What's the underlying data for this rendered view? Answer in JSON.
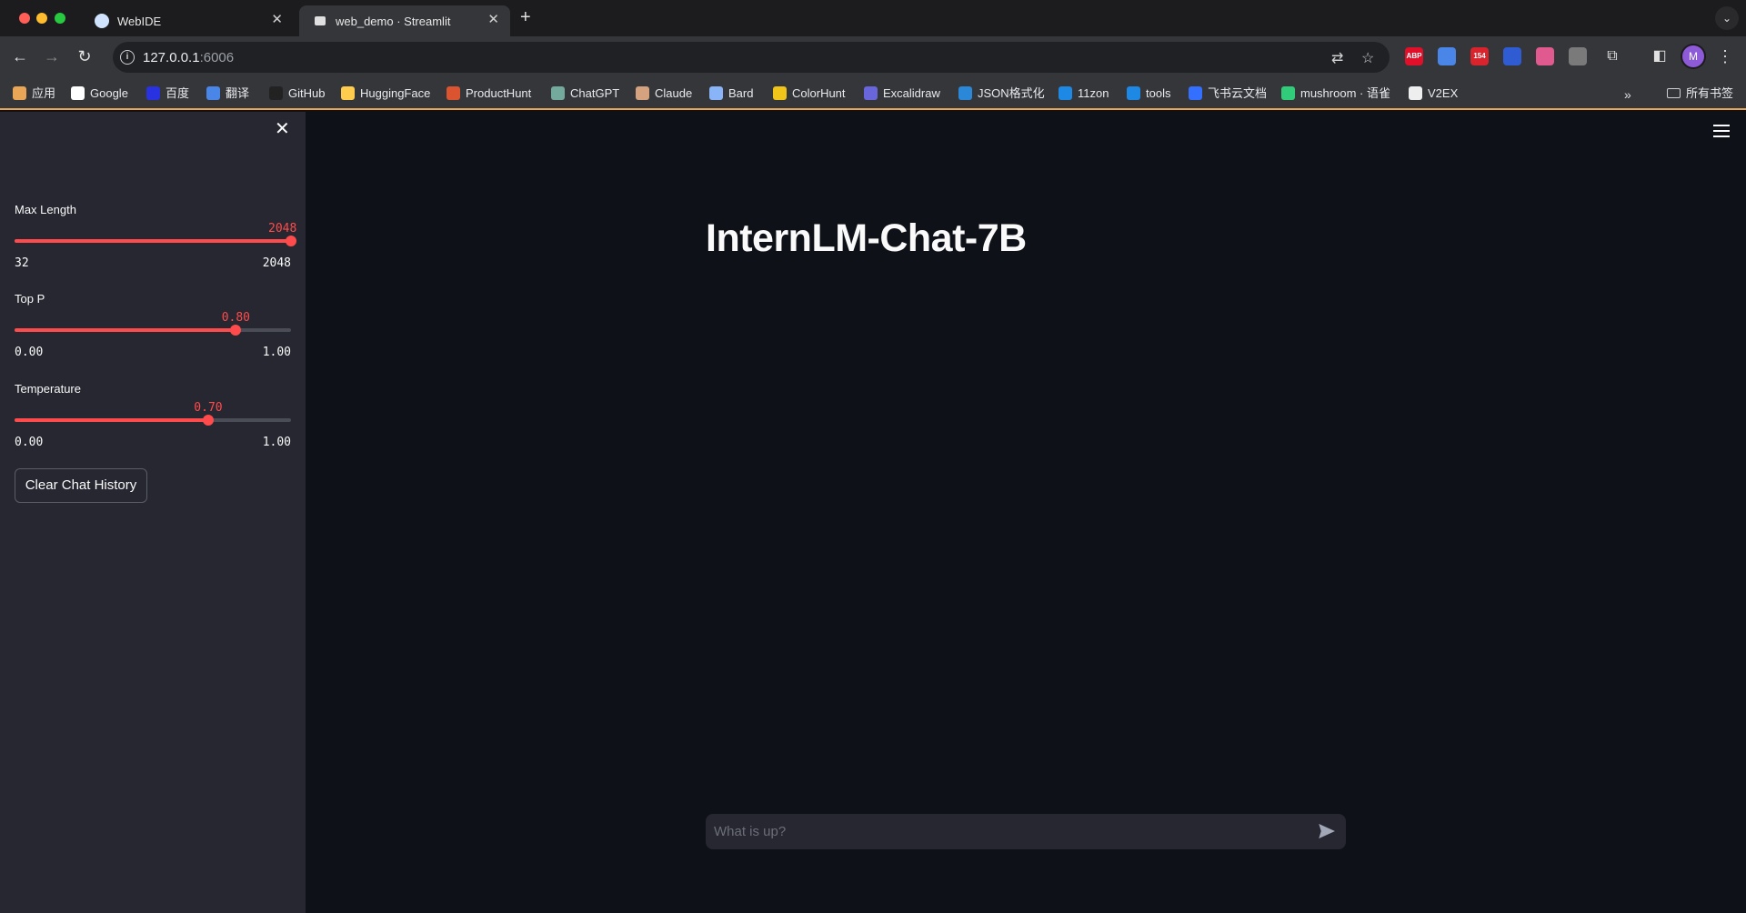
{
  "browser": {
    "tabs": [
      {
        "title": "WebIDE",
        "active": false
      },
      {
        "title": "web_demo · Streamlit",
        "active": true
      }
    ],
    "url_host": "127.0.0.1",
    "url_port": ":6006",
    "extensions": [
      {
        "name": "adblock-icon",
        "label": "ABP",
        "color": "#e0102a"
      },
      {
        "name": "translate-ext-icon",
        "label": "",
        "color": "#4a86e8"
      },
      {
        "name": "calendar-badge-icon",
        "label": "154",
        "color": "#d9232d"
      },
      {
        "name": "star-ext-icon",
        "label": "",
        "color": "#2f5bd3"
      },
      {
        "name": "translate-ext2-icon",
        "label": "",
        "color": "#e05a8f"
      },
      {
        "name": "gray-ext-icon",
        "label": "",
        "color": "#7a7a7a"
      }
    ],
    "avatar_letter": "M",
    "bookmarks": [
      {
        "label": "应用",
        "color": "#e8a656"
      },
      {
        "label": "Google",
        "color": "#ffffff"
      },
      {
        "label": "百度",
        "color": "#2932e1"
      },
      {
        "label": "翻译",
        "color": "#4a86e8"
      },
      {
        "label": "GitHub",
        "color": "#222222"
      },
      {
        "label": "HuggingFace",
        "color": "#ffcc4d"
      },
      {
        "label": "ProductHunt",
        "color": "#da552f"
      },
      {
        "label": "ChatGPT",
        "color": "#74aa9c"
      },
      {
        "label": "Claude",
        "color": "#d4a27f"
      },
      {
        "label": "Bard",
        "color": "#8ab4f8"
      },
      {
        "label": "ColorHunt",
        "color": "#f0c419"
      },
      {
        "label": "Excalidraw",
        "color": "#6965db"
      },
      {
        "label": "JSON格式化",
        "color": "#2b88d8"
      },
      {
        "label": "11zon",
        "color": "#1e88e5"
      },
      {
        "label": "tools",
        "color": "#1e88e5"
      },
      {
        "label": "飞书云文档",
        "color": "#3370ff"
      },
      {
        "label": "mushroom · 语雀",
        "color": "#31cc79"
      },
      {
        "label": "V2EX",
        "color": "#eeeeee"
      }
    ],
    "bookmarks_folder": "所有书签"
  },
  "sidebar": {
    "sliders": [
      {
        "label": "Max Length",
        "value": "2048",
        "min": "32",
        "max": "2048",
        "fraction": 1.0
      },
      {
        "label": "Top P",
        "value": "0.80",
        "min": "0.00",
        "max": "1.00",
        "fraction": 0.8
      },
      {
        "label": "Temperature",
        "value": "0.70",
        "min": "0.00",
        "max": "1.00",
        "fraction": 0.7
      }
    ],
    "clear_button": "Clear Chat History"
  },
  "main": {
    "title": "InternLM-Chat-7B",
    "chat_placeholder": "What is up?"
  },
  "colors": {
    "accent": "#ff4b4b",
    "sidebar_bg": "#262730",
    "main_bg": "#0e1117"
  }
}
